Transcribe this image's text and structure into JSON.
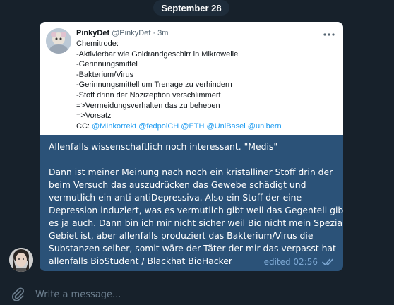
{
  "chat": {
    "date_label": "September 28"
  },
  "tweet": {
    "name": "PinkyDef",
    "handle": "@PinkyDef",
    "separator": "·",
    "time": "3m",
    "more_icon": "ellipsis-icon",
    "lines": [
      "Chemitrode:",
      "-Aktivierbar wie Goldrandgeschirr in Mikrowelle",
      "-Gerinnungsmittel",
      "-Bakterium/Virus",
      "-Gerinnungsmittell um Trenage zu verhindern",
      "-Stoff drinn der Nozizeption verschlimmert",
      "=>Vermeidungsverhalten das zu beheben",
      "=>Vorsatz"
    ],
    "cc_label": "CC:",
    "mentions": [
      "@MInkorrekt",
      "@fedpolCH",
      "@ETH",
      "@UniBasel",
      "@unibern"
    ]
  },
  "message": {
    "line1": "Allenfalls wissenschaftlich noch interessant. \"Medis\"",
    "lines": [
      "Dann ist meiner Meinung nach noch ein kristalliner Stoff drin der",
      "beim Versuch das auszudrücken das Gewebe schädigt und",
      "vermutlich ein anti-antiDepressiva. Also ein Stoff der eine",
      "Depression induziert, was es vermutlich gibt weil das Gegenteil gibt",
      "es ja auch. Dann bin ich mir nicht sicher weil Bio nicht mein Spezial",
      "Gebiet ist, aber allenfalls produziert das Bakterium/Virus die",
      "Substanzen selber, somit wäre der Täter der mir das verpasst hat",
      "allenfalls BioStudent / Blackhat BioHacker"
    ],
    "status": "edited 02:56",
    "read_icon": "double-check-icon"
  },
  "composer": {
    "placeholder": "Write a message...",
    "attach_icon": "paperclip-icon"
  },
  "colors": {
    "background": "#17212b",
    "bubble": "#2b5278",
    "link": "#1d9bf0",
    "meta": "#7da8d3"
  }
}
